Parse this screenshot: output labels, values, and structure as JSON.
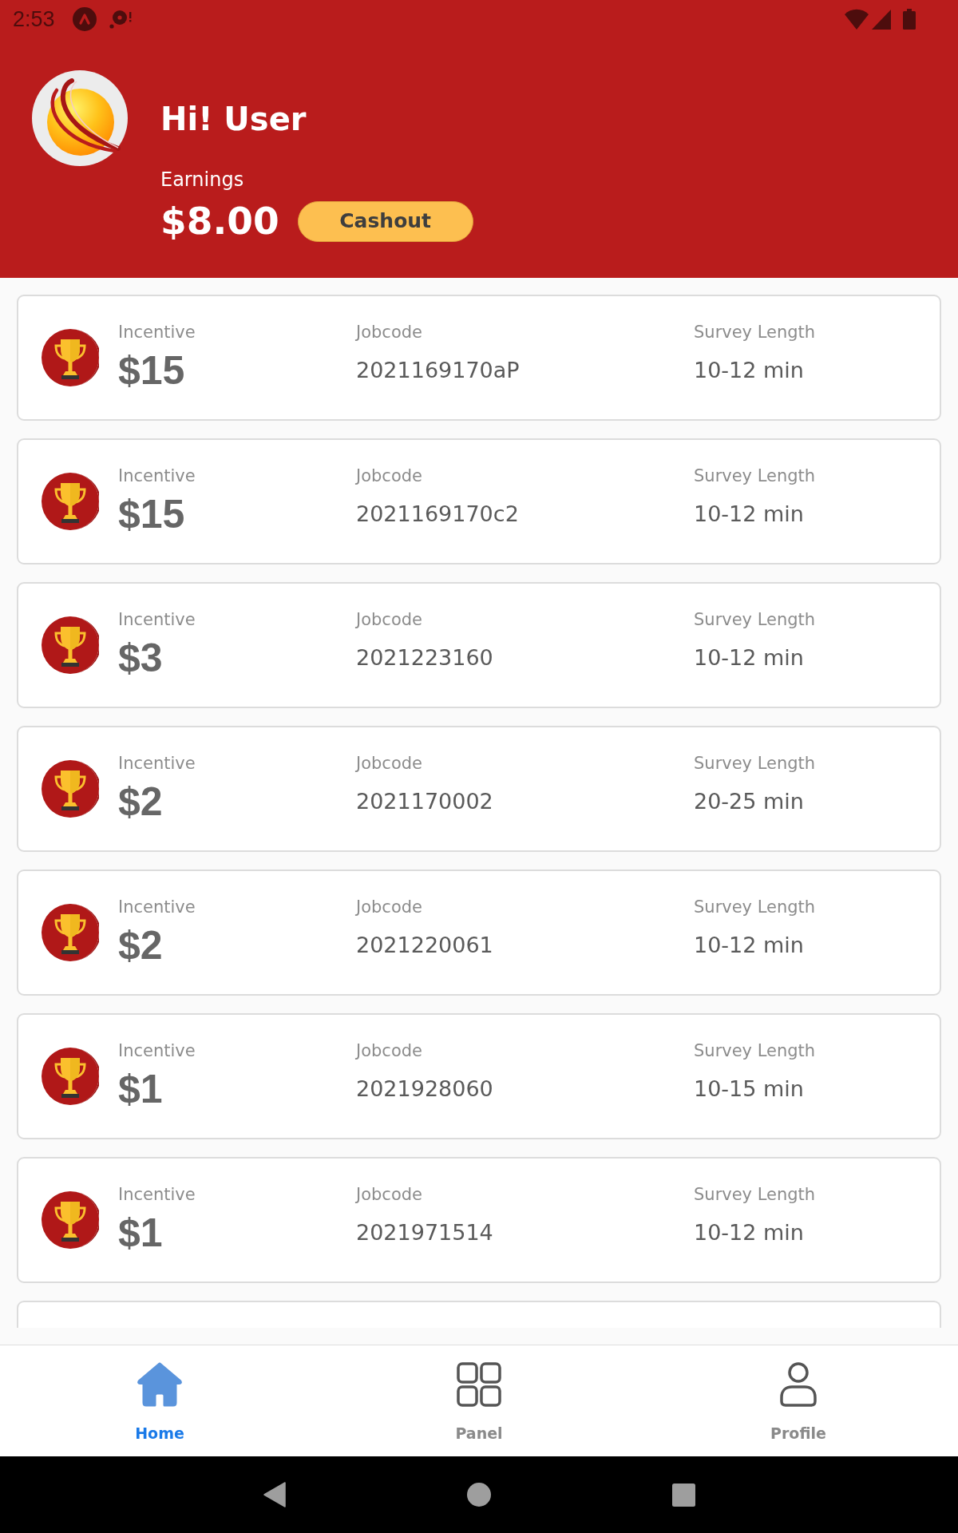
{
  "status_bar": {
    "time": "2:53"
  },
  "header": {
    "greeting": "Hi! User",
    "earnings_label": "Earnings",
    "earnings": "$8.00",
    "cashout": "Cashout"
  },
  "surveys": [
    {
      "incentive_label": "Incentive",
      "incentive": "$15",
      "jobcode_label": "Jobcode",
      "jobcode": "2021169170aP",
      "length_label": "Survey Length",
      "length": "10-12 min"
    },
    {
      "incentive_label": "Incentive",
      "incentive": "$15",
      "jobcode_label": "Jobcode",
      "jobcode": "2021169170c2",
      "length_label": "Survey Length",
      "length": "10-12 min"
    },
    {
      "incentive_label": "Incentive",
      "incentive": "$3",
      "jobcode_label": "Jobcode",
      "jobcode": "2021223160",
      "length_label": "Survey Length",
      "length": "10-12 min"
    },
    {
      "incentive_label": "Incentive",
      "incentive": "$2",
      "jobcode_label": "Jobcode",
      "jobcode": "2021170002",
      "length_label": "Survey Length",
      "length": "20-25 min"
    },
    {
      "incentive_label": "Incentive",
      "incentive": "$2",
      "jobcode_label": "Jobcode",
      "jobcode": "2021220061",
      "length_label": "Survey Length",
      "length": "10-12 min"
    },
    {
      "incentive_label": "Incentive",
      "incentive": "$1",
      "jobcode_label": "Jobcode",
      "jobcode": "2021928060",
      "length_label": "Survey Length",
      "length": "10-15 min"
    },
    {
      "incentive_label": "Incentive",
      "incentive": "$1",
      "jobcode_label": "Jobcode",
      "jobcode": "2021971514",
      "length_label": "Survey Length",
      "length": "10-12 min"
    }
  ],
  "bottom_nav": [
    {
      "label": "Home",
      "kind": "home",
      "selected": true
    },
    {
      "label": "Panel",
      "kind": "grid",
      "selected": false
    },
    {
      "label": "Profile",
      "kind": "person",
      "selected": false
    }
  ]
}
